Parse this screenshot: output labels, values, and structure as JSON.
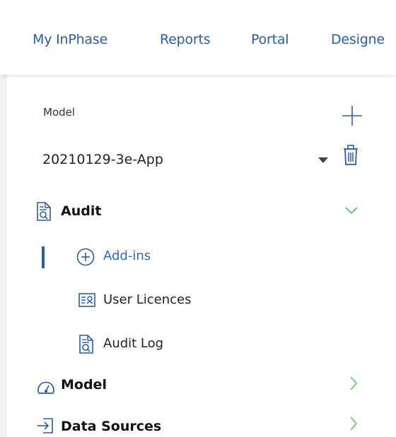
{
  "colors": {
    "brand_blue": "#2e5c9e",
    "active_item": "#2e6bb8",
    "expanded_chevron": "#5cb85c",
    "collapsed_chevron": "#6cbf6c"
  },
  "topnav": {
    "items": [
      {
        "label": "My InPhase"
      },
      {
        "label": "Reports"
      },
      {
        "label": "Portal"
      },
      {
        "label": "Designe"
      }
    ]
  },
  "model_panel": {
    "label": "Model",
    "selected_model": "20210129-3e-App",
    "add_icon": "plus-icon",
    "delete_icon": "trash-icon"
  },
  "tree": {
    "sections": [
      {
        "label": "Audit",
        "icon": "audit-document-icon",
        "expanded": true,
        "children": [
          {
            "label": "Add-ins",
            "icon": "circle-plus-icon",
            "active": true
          },
          {
            "label": "User Licences",
            "icon": "licence-card-icon",
            "active": false
          },
          {
            "label": "Audit Log",
            "icon": "audit-document-icon",
            "active": false
          }
        ]
      },
      {
        "label": "Model",
        "icon": "gauge-icon",
        "expanded": false
      },
      {
        "label": "Data Sources",
        "icon": "import-icon",
        "expanded": false
      }
    ]
  }
}
